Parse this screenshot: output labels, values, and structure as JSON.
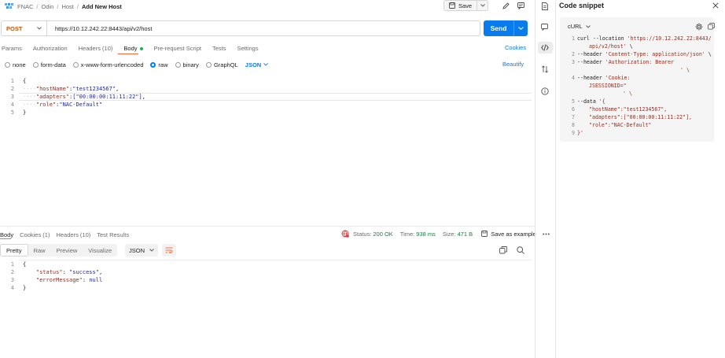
{
  "header": {
    "breadcrumb": [
      "FNAC",
      "Odin",
      "Host",
      "Add New Host"
    ],
    "separator": "/",
    "save_label": "Save"
  },
  "request": {
    "method": "POST",
    "url": "https://10.12.242.22:8443/api/v2/host",
    "send_label": "Send",
    "tabs": [
      {
        "label": "Params"
      },
      {
        "label": "Authorization"
      },
      {
        "label": "Headers (10)"
      },
      {
        "label": "Body"
      },
      {
        "label": "Pre-request Script"
      },
      {
        "label": "Settings"
      }
    ],
    "tests_label": "Tests",
    "cookies_label": "Cookies",
    "body_types": [
      "none",
      "form-data",
      "x-www-form-urlencoded",
      "raw",
      "binary",
      "GraphQL"
    ],
    "selected_body_type": "raw",
    "format": "JSON",
    "beautify_label": "Beautify",
    "body_lines": [
      "1",
      "2",
      "3",
      "4",
      "5"
    ],
    "body": {
      "open": "{",
      "k1": "\"hostName\"",
      "v1": "\"test1234567\"",
      "k2": "\"adapters\"",
      "v2": "[\"00:00:00:11:11:22\"]",
      "k3": "\"role\"",
      "v3": "\"NAC-Default\"",
      "close": "}"
    }
  },
  "response": {
    "tabs": [
      "Body",
      "Cookies (1)",
      "Headers (10)",
      "Test Results"
    ],
    "status_label": "Status:",
    "status_value": "200 OK",
    "time_label": "Time:",
    "time_value": "938 ms",
    "size_label": "Size:",
    "size_value": "471 B",
    "save_example_label": "Save as example",
    "view_tabs": [
      "Pretty",
      "Raw",
      "Preview",
      "Visualize"
    ],
    "format": "JSON",
    "body_lines": [
      "1",
      "2",
      "3",
      "4"
    ],
    "body": {
      "open": "{",
      "k1": "\"status\"",
      "v1": "\"success\"",
      "k2": "\"errorMessage\"",
      "v2": "null",
      "close": "}"
    }
  },
  "snippet": {
    "title": "Code snippet",
    "language": "cURL",
    "line_numbers": [
      "1",
      "2",
      "3",
      "4",
      "5",
      "6",
      "7",
      "8",
      "9"
    ],
    "l1a": "curl --location ",
    "l1b": "'https://10.12.242.22:8443/",
    "l1c": "api/v2/host'",
    "l1d": " \\",
    "l2a": "--header ",
    "l2b": "'Content-Type: application/json'",
    "l2c": " \\",
    "l3a": "--header ",
    "l3b": "'Authorization: Bearer",
    "l3c": "' \\",
    "l4a": "--header ",
    "l4b": "'Cookie:",
    "l4c": "JSESSIONID=\"",
    "l4d": "' \\",
    "l5a": "--data ",
    "l5b": "'{",
    "l6": "\"hostName\":\"test1234567\",",
    "l7": "\"adapters\":[\"00:00:00:11:11:22\"],",
    "l8": "\"role\":\"NAC-Default\"",
    "l9": "}'"
  },
  "colors": {
    "accent": "#097bed",
    "method_post": "#c4560c",
    "status_ok": "#0a8a3c",
    "tab_indicator": "#ff6c37"
  },
  "icons": [
    "app-logo-icon",
    "save-icon",
    "chevron-down-icon",
    "pencil-icon",
    "comment-icon",
    "error-globe-icon",
    "disk-icon",
    "more-horizontal-icon",
    "copy-icon",
    "search-icon",
    "wrap-lines-icon",
    "document-icon",
    "code-icon",
    "arrow-swap-icon",
    "info-icon",
    "gear-icon",
    "close-icon"
  ]
}
